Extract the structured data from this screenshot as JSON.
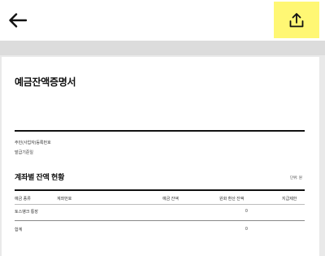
{
  "header": {
    "back_icon": "arrow-left-icon",
    "share_icon": "share-upload-icon",
    "share_bg_color": "#fff774"
  },
  "document": {
    "title": "예금잔액증명서",
    "info_lines": [
      "주민(사업자)등록번호",
      "발급기준일"
    ],
    "section_title": "계좌별 잔액 현황",
    "unit_label": "단위: 원",
    "table": {
      "headers": [
        "예금 종류",
        "계좌번호",
        "예금 잔액",
        "원화 환산 잔액",
        "지급제한"
      ],
      "rows": [
        {
          "type": "토스뱅크 통장",
          "account": "",
          "balance": "",
          "krw": "0",
          "limit": ""
        }
      ],
      "total": {
        "label": "합계",
        "krw": "0"
      }
    }
  }
}
